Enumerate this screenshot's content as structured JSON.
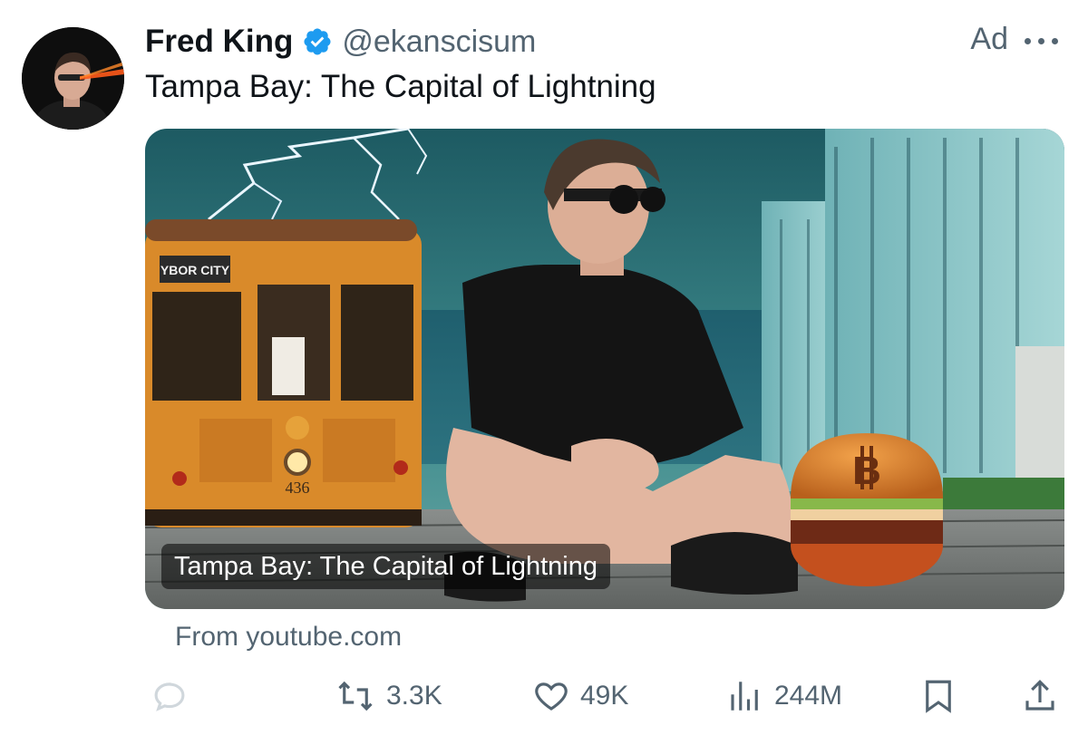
{
  "post": {
    "author_name": "Fred King",
    "handle": "@ekanscisum",
    "ad_label": "Ad",
    "text": "Tampa Bay: The Capital of Lightning"
  },
  "card": {
    "title": "Tampa Bay: The Capital of Lightning",
    "source": "From youtube.com",
    "sign_text": "YBOR CITY",
    "streetcar_number": "436"
  },
  "actions": {
    "reposts": "3.3K",
    "likes": "49K",
    "views": "244M"
  },
  "icons": [
    "verified-badge-icon",
    "more-icon",
    "reply-icon",
    "repost-icon",
    "like-icon",
    "views-icon",
    "bookmark-icon",
    "share-icon"
  ],
  "colors": {
    "verified_blue": "#1d9bf0",
    "muted_text": "#536471",
    "text": "#0f1419"
  }
}
